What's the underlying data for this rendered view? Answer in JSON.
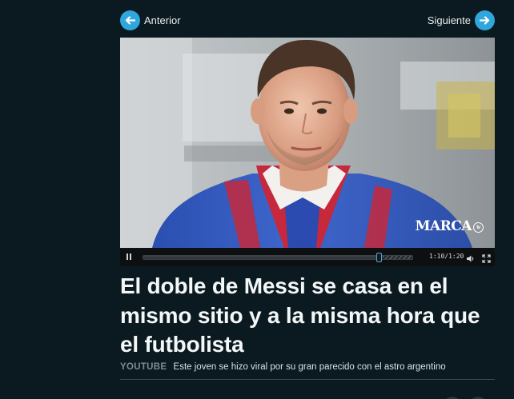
{
  "nav": {
    "prev_label": "Anterior",
    "next_label": "Siguiente",
    "prev_icon": "arrow-left-icon",
    "next_icon": "arrow-right-icon",
    "accent": "#30a7dc"
  },
  "video": {
    "logo": "MARCA",
    "logo_badge": "tv",
    "time": "1:10/1:20",
    "progress": 0.875,
    "buffered_from": 0.89
  },
  "article": {
    "headline": "El doble de Messi se casa en el mismo sitio y a la misma hora que el futbolista",
    "source": "YOUTUBE",
    "summary": "Este joven se hizo viral por su gran parecido con el astro argentino"
  },
  "colors": {
    "background": "#0b1a20",
    "source_label": "#7b8c94"
  }
}
